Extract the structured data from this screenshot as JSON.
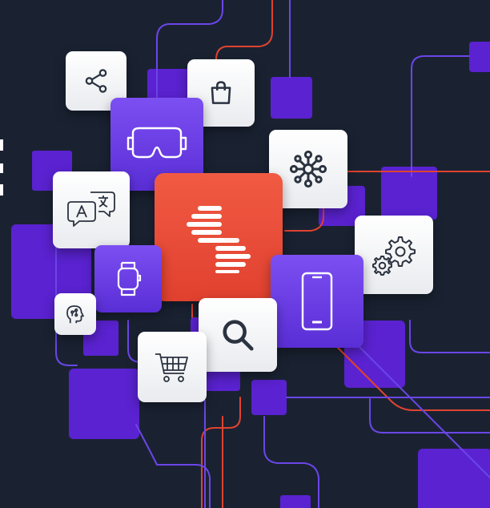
{
  "colors": {
    "background": "#1a2232",
    "accent_purple": "#5a22d0",
    "tile_purple": "#6a3ce6",
    "tile_red": "#e94b36",
    "line_red": "#e0432f",
    "line_purple": "#6b46e8",
    "tile_white": "#f4f5f7",
    "icon_dark": "#2b3340"
  },
  "icons": [
    "share-icon",
    "shopping-bag-icon",
    "vr-headset-icon",
    "network-hub-icon",
    "translate-icon",
    "brand-logo",
    "gear-icon",
    "smartwatch-icon",
    "ai-head-icon",
    "smartphone-icon",
    "search-icon",
    "shopping-cart-icon"
  ]
}
